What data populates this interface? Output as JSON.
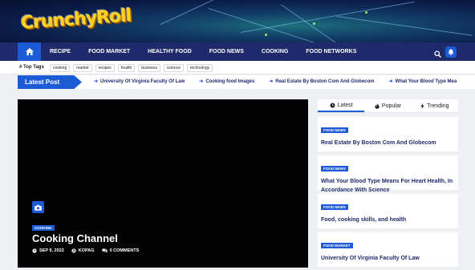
{
  "site": {
    "logo_text": "CrunchyRoll"
  },
  "nav": {
    "items": [
      "RECIPE",
      "FOOD MARKET",
      "HEALTHY FOOD",
      "FOOD NEWS",
      "COOKING",
      "FOOD NETWORKS"
    ],
    "home_icon": "home-icon",
    "search_icon": "search-icon",
    "bell_icon": "bell-icon"
  },
  "tags": {
    "title": "Top Tags",
    "items": [
      "cooking",
      "market",
      "recipes",
      "health",
      "business",
      "science",
      "technology"
    ]
  },
  "ticker": {
    "label": "Latest Post",
    "items": [
      "University Of Virginia Faculty Of Law",
      "Cooking food Images",
      "Real Estate By Boston Com And Globecom",
      "What Your Blood Type Mea"
    ]
  },
  "featured": {
    "category": "COOKING",
    "title": "Cooking Channel",
    "date": "SEP 9, 2022",
    "author": "KOPAG",
    "comments": "0 COMMENTS"
  },
  "sidebar": {
    "tabs": [
      "Latest",
      "Popular",
      "Trending"
    ],
    "posts": [
      {
        "category": "FOOD NEWS",
        "title": "Real Estate By Boston Com And Globecom"
      },
      {
        "category": "FOOD NEWS",
        "title": "What Your Blood Type Means For Heart Health, In Accordance With Science"
      },
      {
        "category": "FOOD NEWS",
        "title": "Food, cooking skills, and health"
      },
      {
        "category": "FOOD MARKET",
        "title": "University Of Virginia Faculty Of Law"
      }
    ]
  },
  "colors": {
    "accent": "#1d5ad6",
    "navbar": "#1f2a6c"
  }
}
